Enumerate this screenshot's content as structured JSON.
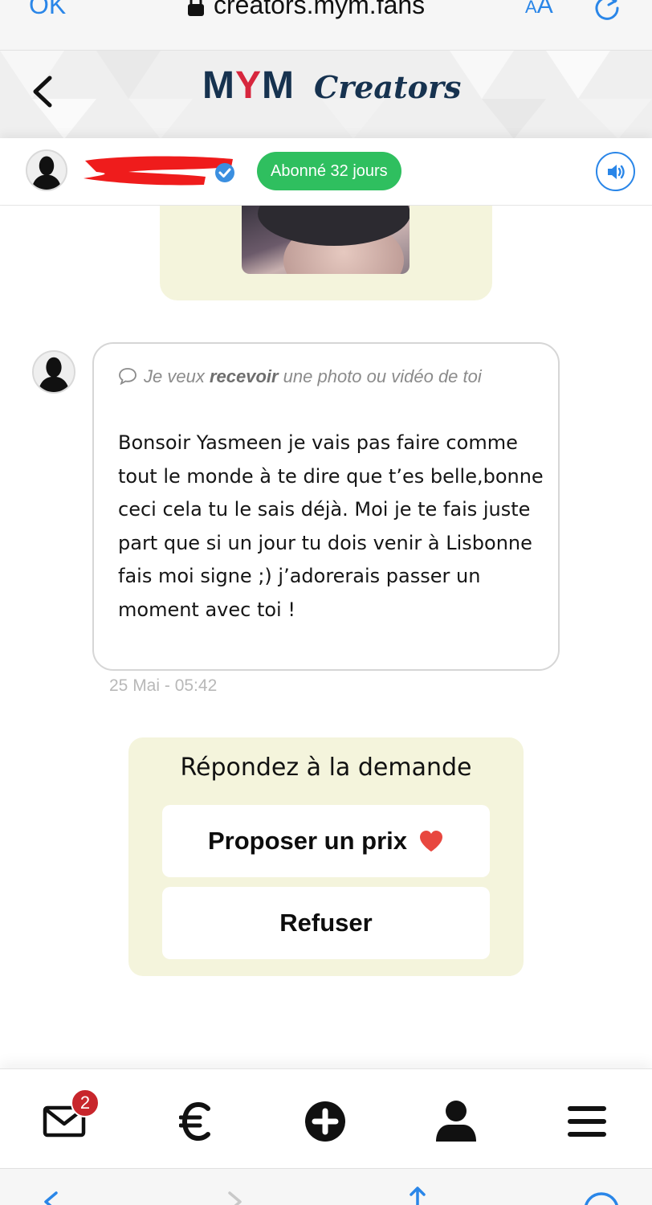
{
  "browser": {
    "done_label": "OK",
    "url": "creators.mym.fans",
    "text_size_label_small": "A",
    "text_size_label_large": "A"
  },
  "header": {
    "brand_mym_pre": "M",
    "brand_mym_y": "Y",
    "brand_mym_post": "M",
    "brand_creators": "Creators"
  },
  "profile": {
    "status_badge": "Abonné 32 jours"
  },
  "message": {
    "request_pre": "Je veux ",
    "request_bold": "recevoir",
    "request_post": " une photo ou vidéo de toi",
    "text": "Bonsoir Yasmeen je vais pas faire comme tout le monde à te dire que t’es belle,bonne ceci cela tu le sais déjà. Moi je te fais juste part que si un jour tu dois venir à Lisbonne fais moi signe ;) j’adorerais passer un moment avec toi !",
    "timestamp": "25 Mai - 05:42"
  },
  "response": {
    "title": "Répondez à la demande",
    "propose_label": "Proposer un prix",
    "refuse_label": "Refuser"
  },
  "bottom_nav": {
    "messages_badge": "2",
    "items": [
      "envelope-icon",
      "euro-icon",
      "plus-circle-icon",
      "user-icon",
      "menu-icon"
    ]
  },
  "colors": {
    "brand_navy": "#16324f",
    "brand_red": "#d7263d",
    "badge_green": "#2fbf5f",
    "card_cream": "#f4f4dc",
    "link_blue": "#2a86e8",
    "heart_red": "#e8473f",
    "notif_red": "#c8262c"
  }
}
